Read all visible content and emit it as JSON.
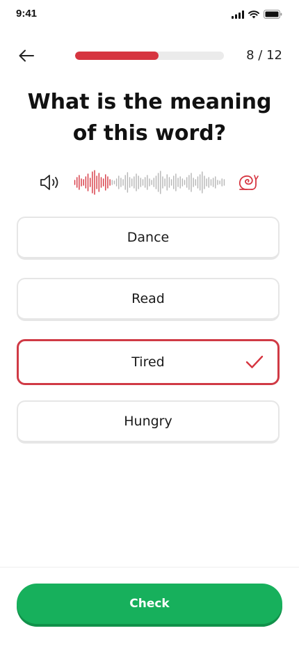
{
  "status_bar": {
    "time": "9:41",
    "icons": [
      "signal-icon",
      "wifi-icon",
      "battery-icon"
    ]
  },
  "header": {
    "back_icon": "arrow-left-icon",
    "progress": {
      "current": 8,
      "total": 12,
      "fraction": 0.5625
    },
    "progress_text": "8 / 12"
  },
  "question": {
    "text": "What is the meaning of this word?"
  },
  "audio": {
    "speaker_icon": "speaker-icon",
    "waveform_icon": "waveform-icon",
    "slow_icon": "snail-icon",
    "played_fraction": 0.25
  },
  "options": [
    {
      "label": "Dance",
      "selected": false
    },
    {
      "label": "Read",
      "selected": false
    },
    {
      "label": "Tired",
      "selected": true
    },
    {
      "label": "Hungry",
      "selected": false
    }
  ],
  "actions": {
    "check_label": "Check"
  },
  "colors": {
    "accent_red": "#d63540",
    "track_gray": "#ebebeb",
    "primary_green": "#17b05c",
    "border_gray": "#e6e6e6",
    "waveform_gray": "#b5b5b5"
  }
}
